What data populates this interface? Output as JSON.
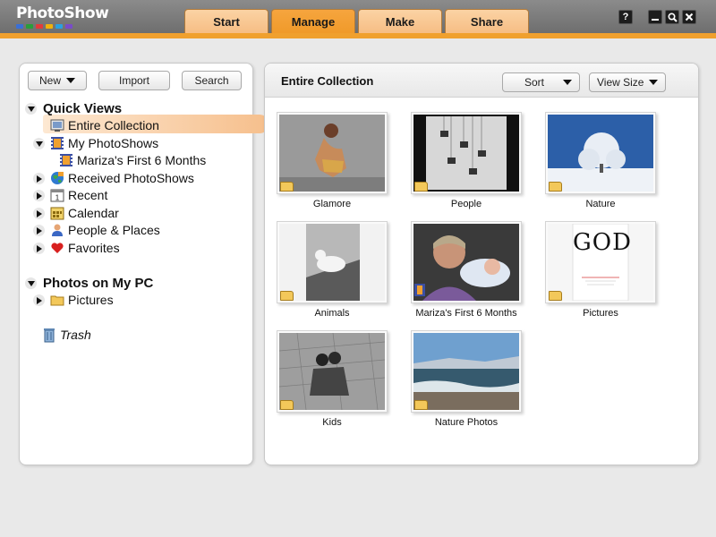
{
  "app": {
    "logo": "PhotoShow",
    "logo_dot_colors": [
      "#3a6fd6",
      "#2a9e3a",
      "#e23a3a",
      "#f0b20a",
      "#29a1e0",
      "#7a4bc9"
    ]
  },
  "tabs": [
    {
      "label": "Start",
      "active": false
    },
    {
      "label": "Manage",
      "active": true
    },
    {
      "label": "Make",
      "active": false
    },
    {
      "label": "Share",
      "active": false
    }
  ],
  "window_buttons": {
    "help": "?",
    "minimize": "–",
    "search": "🔍",
    "close": "✕"
  },
  "left_panel": {
    "buttons": {
      "new": "New",
      "import": "Import",
      "search": "Search"
    },
    "quick_views_title": "Quick Views",
    "items": {
      "entire_collection": "Entire Collection",
      "my_photoshows": "My PhotoShows",
      "marizas_first": "Mariza's First 6 Months",
      "received": "Received PhotoShows",
      "recent": "Recent",
      "calendar": "Calendar",
      "people_places": "People & Places",
      "favorites": "Favorites"
    },
    "photos_title": "Photos on My PC",
    "pictures": "Pictures",
    "trash": "Trash"
  },
  "main": {
    "title": "Entire Collection",
    "sort_label": "Sort",
    "view_size_label": "View Size",
    "albums": [
      {
        "label": "Glamore",
        "type": "folder"
      },
      {
        "label": "People",
        "type": "folder"
      },
      {
        "label": "Nature",
        "type": "folder"
      },
      {
        "label": "Animals",
        "type": "folder"
      },
      {
        "label": "Mariza's First 6 Months",
        "type": "photoshow"
      },
      {
        "label": "Pictures",
        "type": "folder"
      },
      {
        "label": "Kids",
        "type": "folder"
      },
      {
        "label": "Nature Photos",
        "type": "folder"
      }
    ],
    "pictures_thumb_text": "GOD"
  }
}
